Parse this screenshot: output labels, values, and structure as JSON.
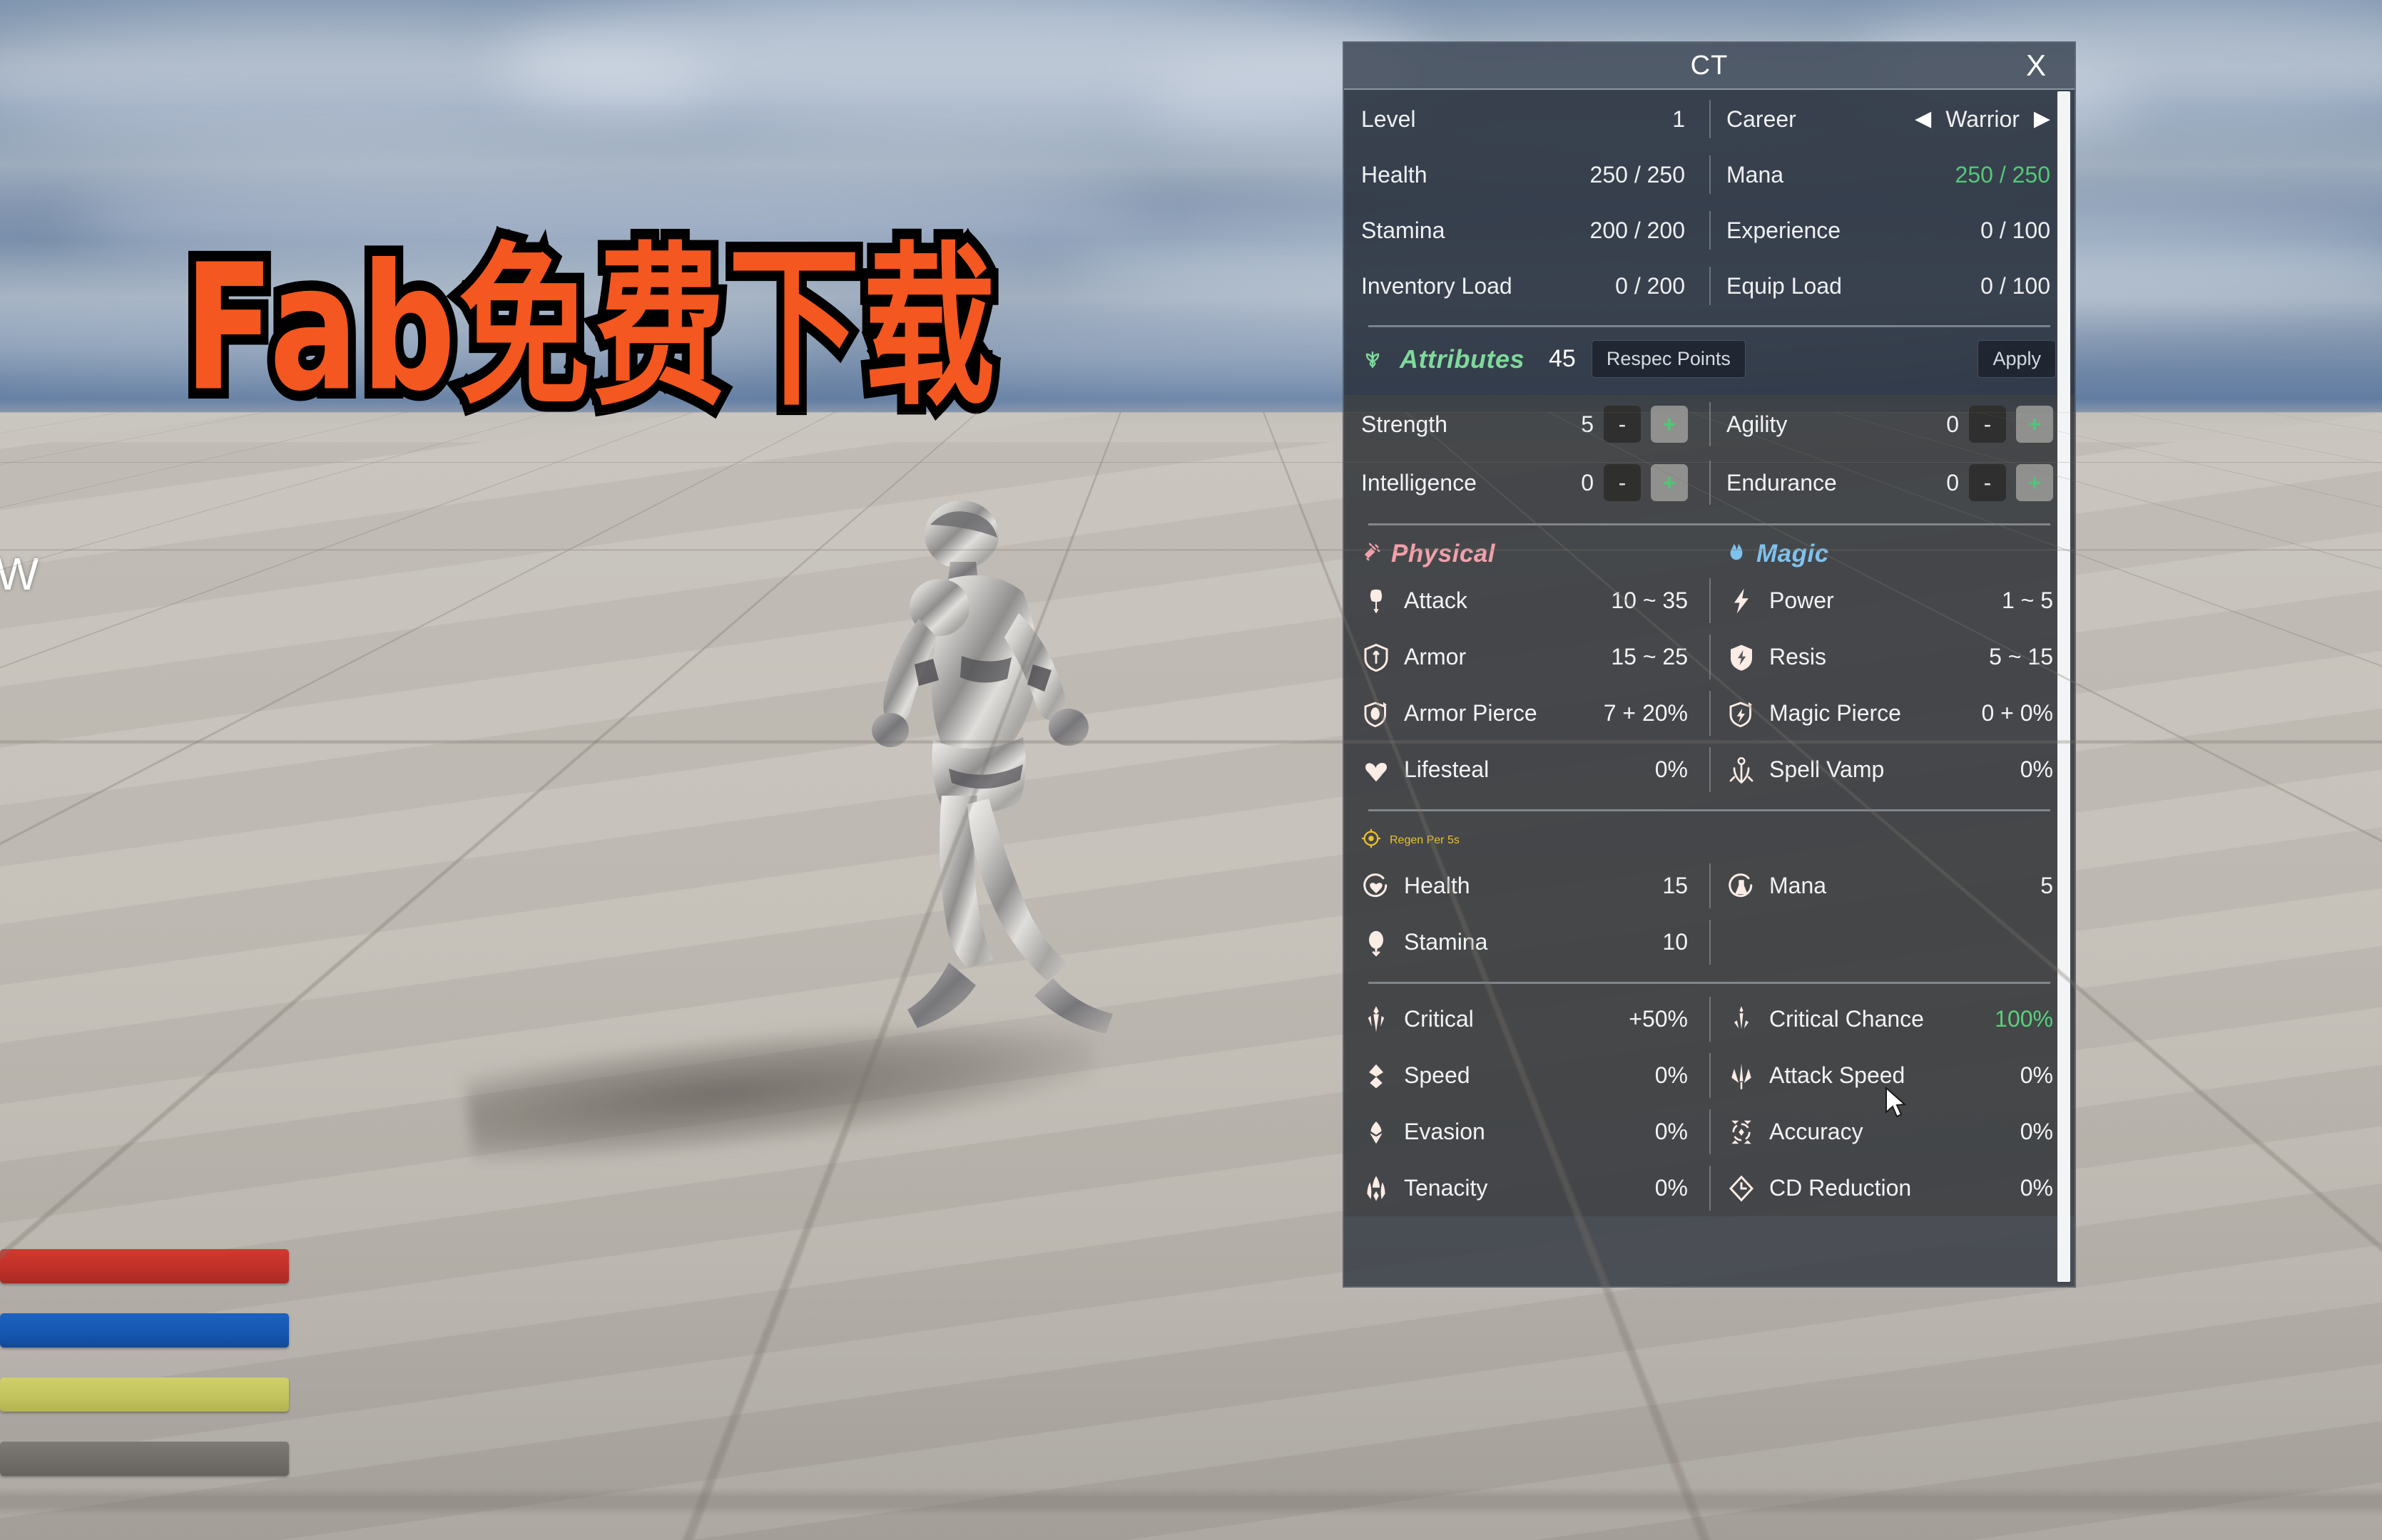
{
  "overlay": {
    "title_text": "Fab免费下载",
    "edge_letter": "W"
  },
  "hud": {
    "bars": [
      {
        "name": "health-bar",
        "color": "#c03129"
      },
      {
        "name": "mana-bar",
        "color": "#1657b0"
      },
      {
        "name": "stamina-bar",
        "color": "#c3c45e"
      },
      {
        "name": "experience-bar",
        "color": "#716e6a"
      }
    ]
  },
  "panel": {
    "title": "CT",
    "close_label": "X",
    "vitals": [
      {
        "left_label": "Level",
        "left_value": "1",
        "right_label": "Career",
        "right_value": "Warrior",
        "right_is_career": true
      },
      {
        "left_label": "Health",
        "left_value": "250 / 250",
        "right_label": "Mana",
        "right_value": "250 / 250",
        "right_green": true
      },
      {
        "left_label": "Stamina",
        "left_value": "200 / 200",
        "right_label": "Experience",
        "right_value": "0 / 100"
      },
      {
        "left_label": "Inventory Load",
        "left_value": "0 / 200",
        "right_label": "Equip Load",
        "right_value": "0 / 100"
      }
    ],
    "career_prev": "◀",
    "career_next": "▶",
    "attributes": {
      "icon": "seedling-icon",
      "title": "Attributes",
      "points": "45",
      "respec_label": "Respec Points",
      "apply_label": "Apply",
      "minus_label": "-",
      "plus_label": "+",
      "rows": [
        {
          "left_label": "Strength",
          "left_value": "5",
          "right_label": "Agility",
          "right_value": "0"
        },
        {
          "left_label": "Intelligence",
          "left_value": "0",
          "right_label": "Endurance",
          "right_value": "0"
        }
      ]
    },
    "categories": {
      "physical": {
        "label": "Physical",
        "color": "#f2a0ab"
      },
      "magic": {
        "label": "Magic",
        "color": "#7fc2ef"
      },
      "regen": {
        "label": "Regen Per 5s",
        "color": "#ecc22d"
      }
    },
    "combat_rows": [
      {
        "left_icon": "axe-icon",
        "left_label": "Attack",
        "left_value": "10 ~ 35",
        "right_icon": "lightning-icon",
        "right_label": "Power",
        "right_value": "1 ~ 5"
      },
      {
        "left_icon": "shield-icon",
        "left_label": "Armor",
        "left_value": "15 ~ 25",
        "right_icon": "shield-bolt-icon",
        "right_label": "Resis",
        "right_value": "5 ~ 15"
      },
      {
        "left_icon": "shield-pierce-icon",
        "left_label": "Armor Pierce",
        "left_value": "7 + 20%",
        "right_icon": "shield-magic-pierce-icon",
        "right_label": "Magic Pierce",
        "right_value": "0 + 0%"
      },
      {
        "left_icon": "heart-drain-icon",
        "left_label": "Lifesteal",
        "left_value": "0%",
        "right_icon": "spell-vamp-icon",
        "right_label": "Spell Vamp",
        "right_value": "0%"
      }
    ],
    "regen_rows": [
      {
        "left_icon": "heart-regen-icon",
        "left_label": "Health",
        "left_value": "15",
        "right_icon": "flask-regen-icon",
        "right_label": "Mana",
        "right_value": "5"
      },
      {
        "left_icon": "stamina-regen-icon",
        "left_label": "Stamina",
        "left_value": "10",
        "right_icon": "",
        "right_label": "",
        "right_value": ""
      }
    ],
    "secondary_rows": [
      {
        "left_icon": "crit-dagger-icon",
        "left_label": "Critical",
        "left_value": "+50%",
        "right_icon": "crit-chance-icon",
        "right_label": "Critical Chance",
        "right_value": "100%",
        "right_green": true
      },
      {
        "left_icon": "speed-chevron-icon",
        "left_label": "Speed",
        "left_value": "0%",
        "right_icon": "attack-speed-icon",
        "right_label": "Attack Speed",
        "right_value": "0%"
      },
      {
        "left_icon": "evasion-icon",
        "left_label": "Evasion",
        "left_value": "0%",
        "right_icon": "accuracy-icon",
        "right_label": "Accuracy",
        "right_value": "0%"
      },
      {
        "left_icon": "tenacity-icon",
        "left_label": "Tenacity",
        "left_value": "0%",
        "right_icon": "cooldown-icon",
        "right_label": "CD Reduction",
        "right_value": "0%"
      }
    ]
  }
}
